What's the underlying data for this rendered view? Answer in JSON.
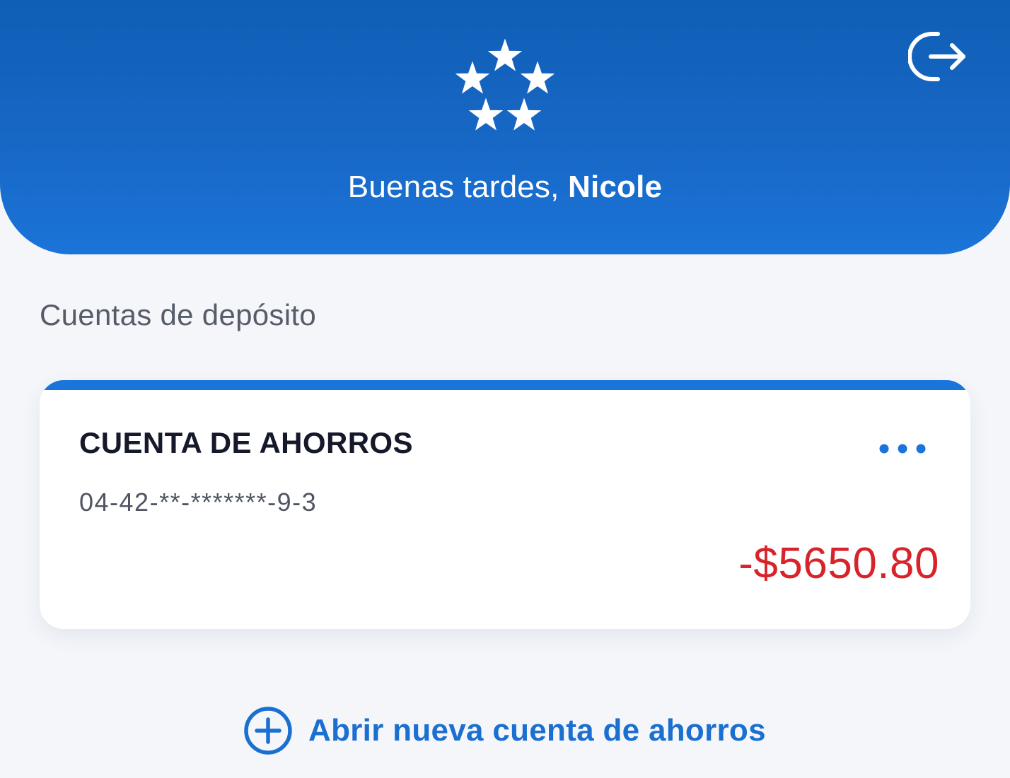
{
  "header": {
    "greeting_prefix": "Buenas tardes, ",
    "user_name": "Nicole",
    "logo_icon": "five-stars-logo-icon",
    "logout_icon": "logout-icon"
  },
  "section": {
    "title": "Cuentas de depósito"
  },
  "account_card": {
    "type_label": "CUENTA DE AHORROS",
    "account_number": "04-42-**-*******-9-3",
    "balance": "-$5650.80",
    "menu_icon": "more-horizontal-icon"
  },
  "actions": {
    "open_account_label": "Abrir nueva cuenta de ahorros",
    "open_account_icon": "plus-circle-icon"
  },
  "colors": {
    "header_blue": "#1767c5",
    "accent_blue": "#1a74dc",
    "negative_red": "#d8232b",
    "background": "#f4f6fa"
  }
}
